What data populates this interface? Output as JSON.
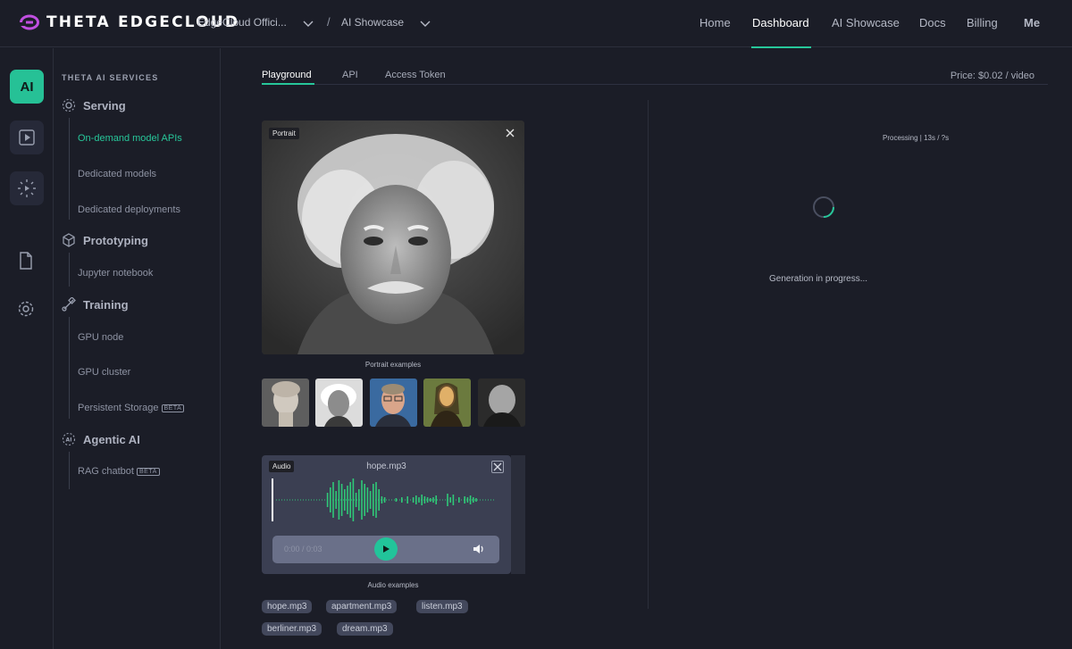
{
  "brand": {
    "name": "THETA EDGECLOUD",
    "accent": "#27c79a",
    "logo_color": "#c04fe0"
  },
  "breadcrumb": {
    "org": "EdgeCloud Offici...",
    "section": "AI Showcase"
  },
  "nav": {
    "items": [
      "Home",
      "Dashboard",
      "AI Showcase",
      "Docs",
      "Billing",
      "Me"
    ],
    "active": "Dashboard"
  },
  "rail": {
    "ai_label": "AI"
  },
  "sidebar": {
    "heading": "THETA AI SERVICES",
    "groups": [
      {
        "label": "Serving",
        "items": [
          "On-demand model APIs",
          "Dedicated models",
          "Dedicated deployments"
        ]
      },
      {
        "label": "Prototyping",
        "items": [
          "Jupyter notebook"
        ]
      },
      {
        "label": "Training",
        "items": [
          "GPU node",
          "GPU cluster",
          "Persistent Storage"
        ]
      },
      {
        "label": "Agentic AI",
        "items": [
          "RAG chatbot"
        ]
      }
    ],
    "active_item": "On-demand model APIs",
    "beta_label": "BETA"
  },
  "tabs": {
    "items": [
      "Playground",
      "API",
      "Access Token"
    ],
    "active": "Playground"
  },
  "price": "Price: $0.02 / video",
  "portrait": {
    "tag": "Portrait",
    "caption": "Portrait examples"
  },
  "audio": {
    "tag": "Audio",
    "filename": "hope.mp3",
    "time": "0:00 / 0:03",
    "caption": "Audio examples",
    "examples": [
      "hope.mp3",
      "apartment.mp3",
      "listen.mp3",
      "berliner.mp3",
      "dream.mp3"
    ]
  },
  "status": {
    "processing": "Processing | 13s / ?s",
    "message": "Generation in progress..."
  }
}
